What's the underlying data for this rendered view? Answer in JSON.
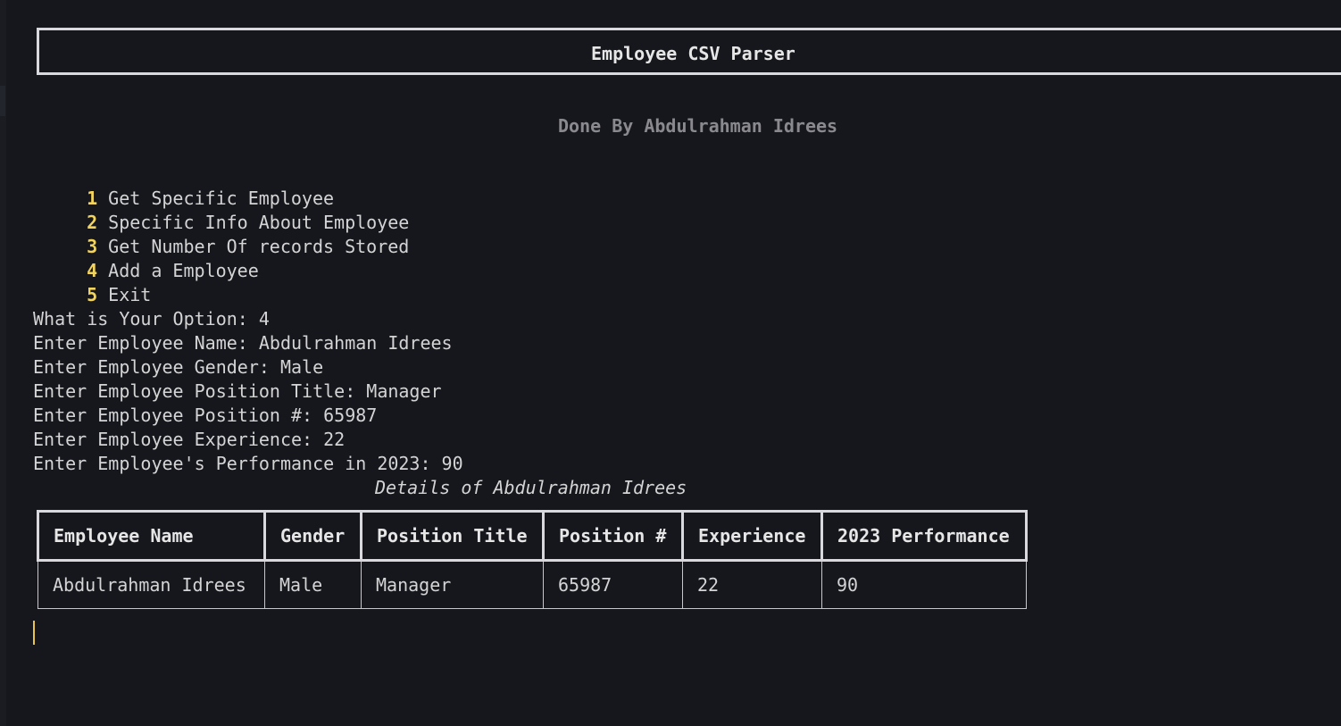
{
  "header": {
    "title": "Employee CSV Parser",
    "subtitle": "Done By Abdulrahman Idrees"
  },
  "menu": {
    "items": [
      {
        "number": "1",
        "label": "Get Specific Employee"
      },
      {
        "number": "2",
        "label": "Specific Info About Employee"
      },
      {
        "number": "3",
        "label": "Get Number Of records Stored"
      },
      {
        "number": "4",
        "label": "Add a Employee"
      },
      {
        "number": "5",
        "label": "Exit"
      }
    ]
  },
  "session": {
    "lines": [
      "What is Your Option: 4",
      "Enter Employee Name: Abdulrahman Idrees",
      "Enter Employee Gender: Male",
      "Enter Employee Position Title: Manager",
      "Enter Employee Position #: 65987",
      "Enter Employee Experience: 22",
      "Enter Employee's Performance in 2023: 90"
    ]
  },
  "details": {
    "caption": "Details of Abdulrahman Idrees",
    "columns": [
      "Employee Name",
      "Gender",
      "Position Title",
      "Position #",
      "Experience",
      "2023 Performance"
    ],
    "rows": [
      [
        "Abdulrahman Idrees",
        "Male",
        "Manager",
        "65987",
        "22",
        "90"
      ]
    ]
  },
  "colors": {
    "background": "#16171d",
    "menu_number": "#f2d35b",
    "cursor": "#e8c44a",
    "subtitle": "#8a8a8e"
  }
}
